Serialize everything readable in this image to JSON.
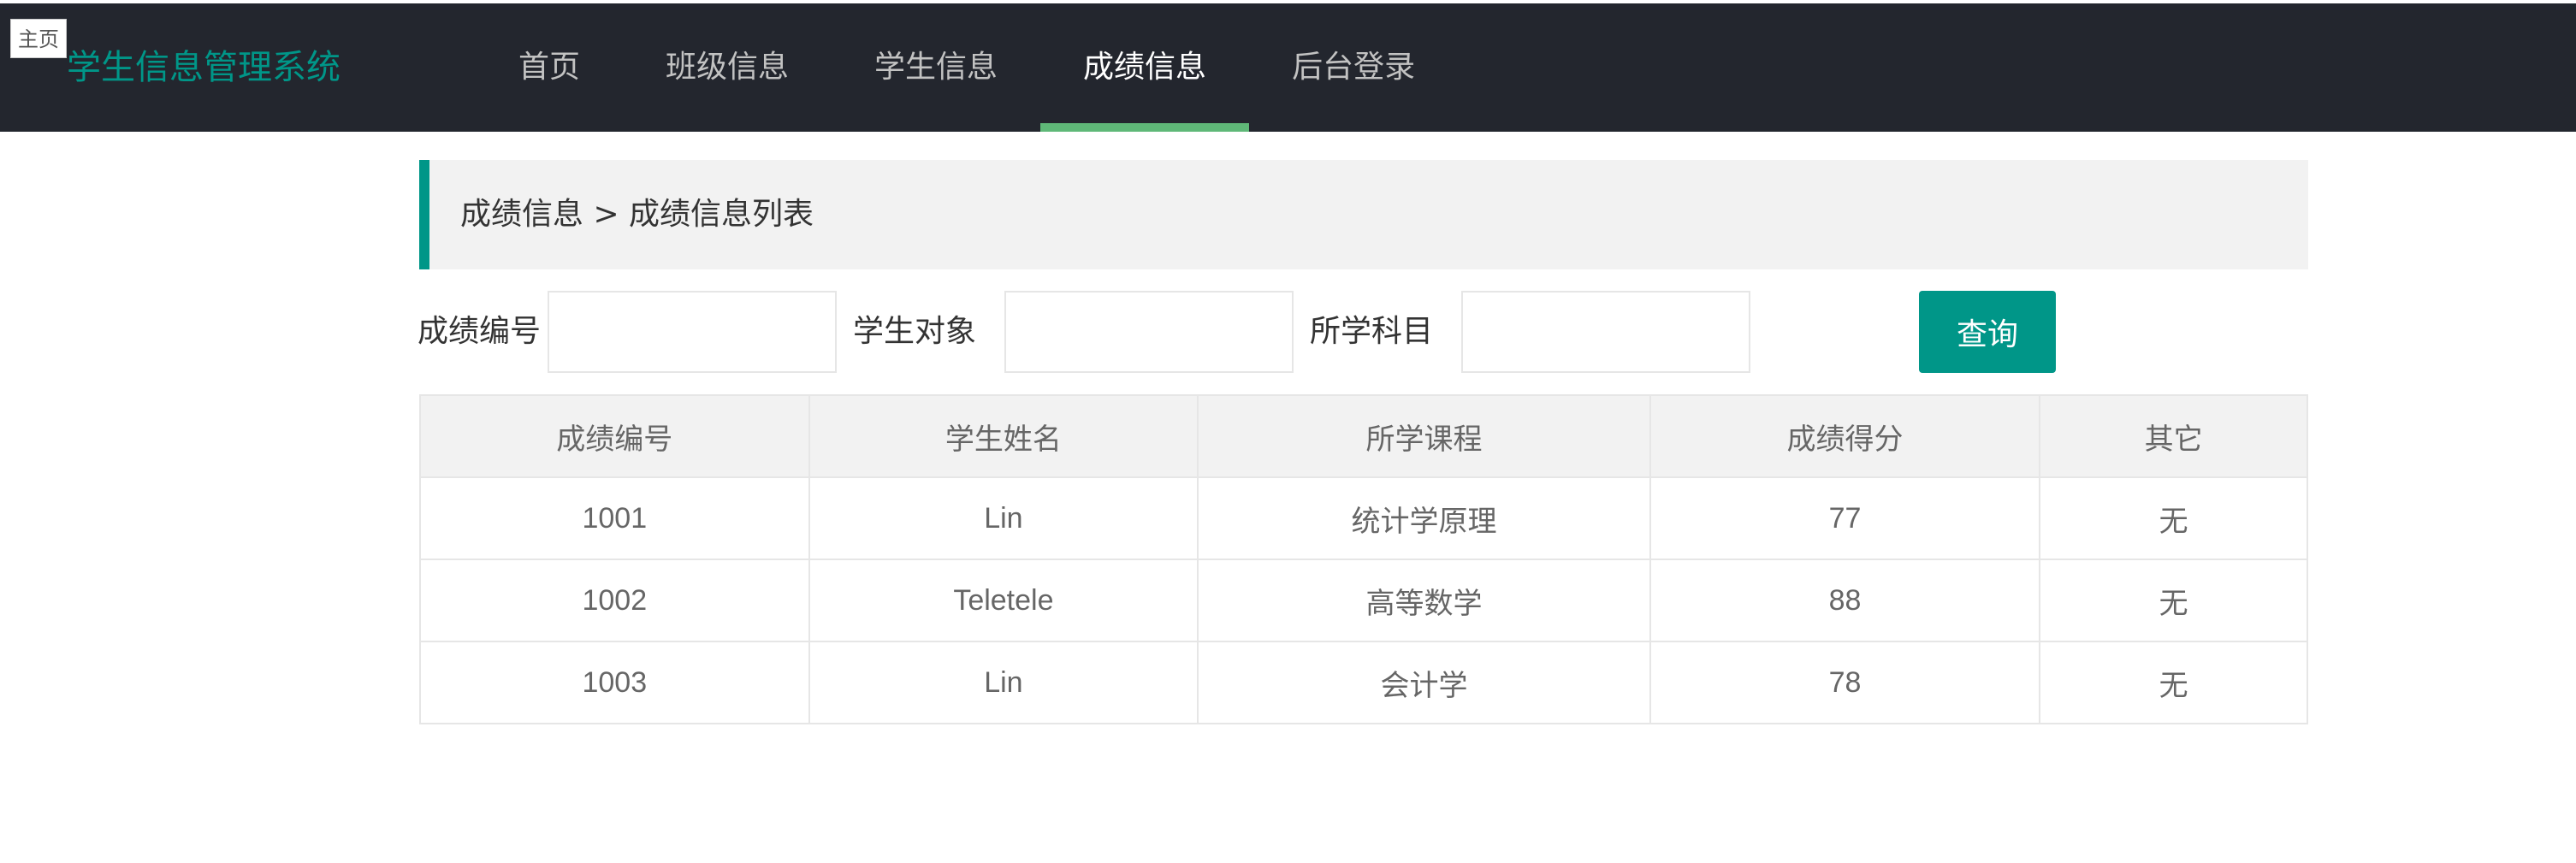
{
  "home_tab": "主页",
  "brand": "学生信息管理系统",
  "nav": [
    {
      "label": "首页"
    },
    {
      "label": "班级信息"
    },
    {
      "label": "学生信息"
    },
    {
      "label": "成绩信息",
      "active": true
    },
    {
      "label": "后台登录"
    }
  ],
  "breadcrumb": "成绩信息 > 成绩信息列表",
  "search": {
    "score_id_label": "成绩编号",
    "score_id_value": "",
    "student_label": "学生对象",
    "student_value": "",
    "subject_label": "所学科目",
    "subject_value": "",
    "button_label": "查询"
  },
  "table": {
    "headers": [
      "成绩编号",
      "学生姓名",
      "所学课程",
      "成绩得分",
      "其它"
    ],
    "rows": [
      [
        "1001",
        "Lin",
        "统计学原理",
        "77",
        "无"
      ],
      [
        "1002",
        "Teletele",
        "高等数学",
        "88",
        "无"
      ],
      [
        "1003",
        "Lin",
        "会计学",
        "78",
        "无"
      ]
    ]
  },
  "colors": {
    "topbar": "#23262e",
    "brand": "#009688",
    "accent": "#009688",
    "active_underline": "#5fb878"
  }
}
